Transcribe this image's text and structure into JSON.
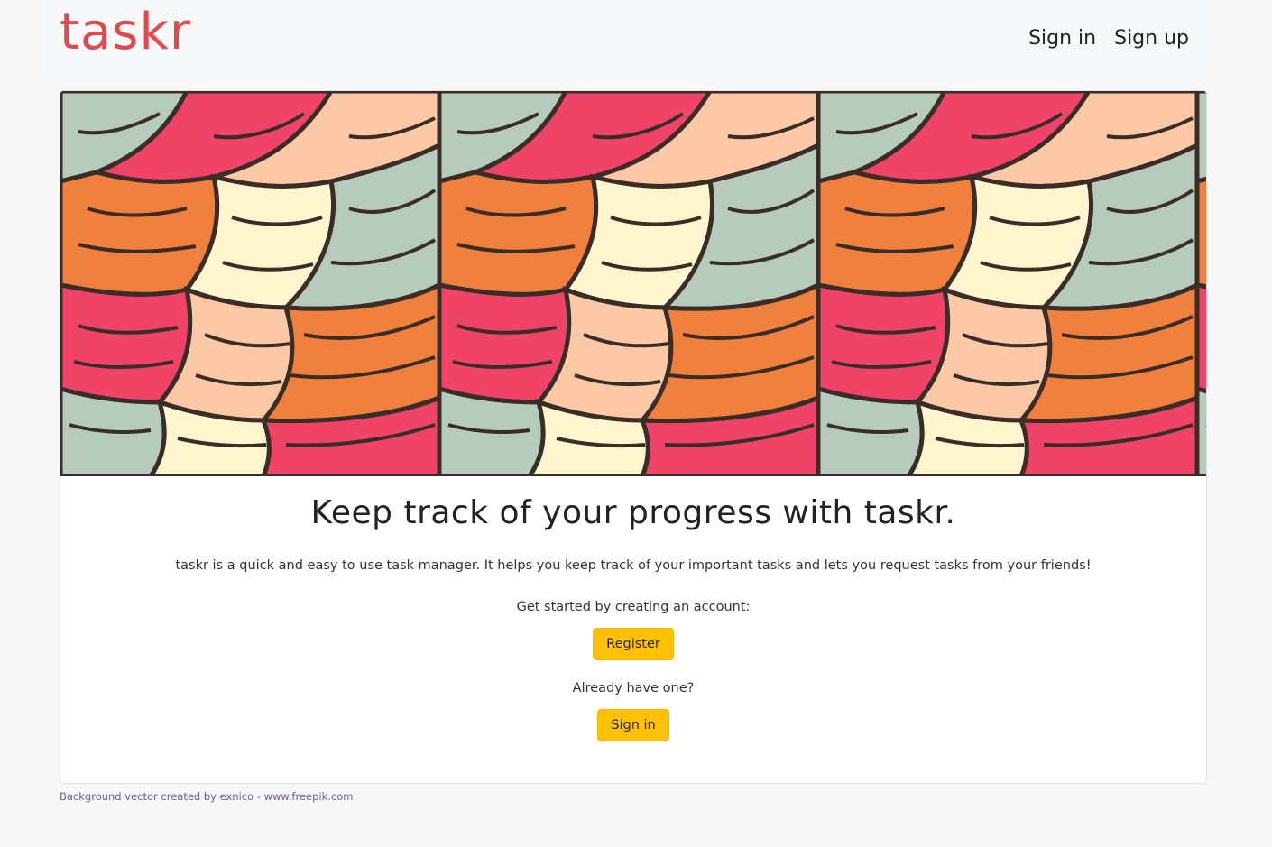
{
  "navbar": {
    "brand": "taskr",
    "links": [
      "Sign in",
      "Sign up"
    ]
  },
  "hero": {
    "image_description": "Colorful abstract wavy leaf pattern background",
    "colors": [
      "#ef4468",
      "#f0803e",
      "#fcc8a6",
      "#fff6d0",
      "#b6cbbc",
      "#3a2d28"
    ]
  },
  "main": {
    "headline": "Keep track of your progress with taskr.",
    "description": "taskr is a quick and easy to use task manager. It helps you keep track of your important tasks and lets you request tasks from your friends!",
    "register_prompt": "Get started by creating an account:",
    "register_button": "Register",
    "signin_prompt": "Already have one?",
    "signin_button": "Sign in"
  },
  "footer": {
    "credit": "Background vector created by exnico - www.freepik.com"
  },
  "colors": {
    "brand": "#e04a4e",
    "button": "#ffc107",
    "link": "#6a5e96"
  }
}
